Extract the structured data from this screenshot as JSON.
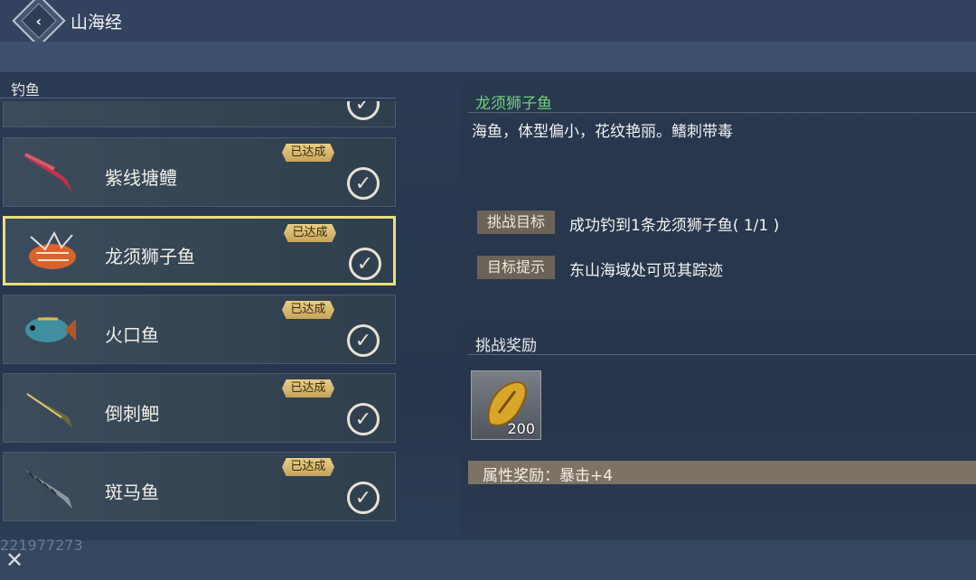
{
  "header": {
    "back_icon": "chevron-left-icon",
    "title": "山海经"
  },
  "category": {
    "label": "钓鱼"
  },
  "fish_list": [
    {
      "name": "紫线塘鳢",
      "badge": "已达成",
      "selected": false
    },
    {
      "name": "龙须狮子鱼",
      "badge": "已达成",
      "selected": true
    },
    {
      "name": "火口鱼",
      "badge": "已达成",
      "selected": false
    },
    {
      "name": "倒刺鲃",
      "badge": "已达成",
      "selected": false
    },
    {
      "name": "斑马鱼",
      "badge": "已达成",
      "selected": false
    }
  ],
  "detail": {
    "fish_name": "龙须狮子鱼",
    "description": "海鱼，体型偏小，花纹艳丽。鳍刺带毒",
    "challenge_goal_label": "挑战目标",
    "challenge_goal_text": "成功钓到1条龙须狮子鱼( 1/1 )",
    "hint_label": "目标提示",
    "hint_text": "东山海域处可觅其踪迹"
  },
  "reward": {
    "heading": "挑战奖励",
    "item_icon": "gold-shell-icon",
    "item_qty": "200",
    "attribute_text": "属性奖励：暴击+4"
  },
  "footer": {
    "uid": "221977273",
    "close_icon": "close-icon"
  },
  "colors": {
    "accent_green": "#6fd17a",
    "selected_border": "#e9de7a",
    "badge_gold": "#e7cf86"
  }
}
